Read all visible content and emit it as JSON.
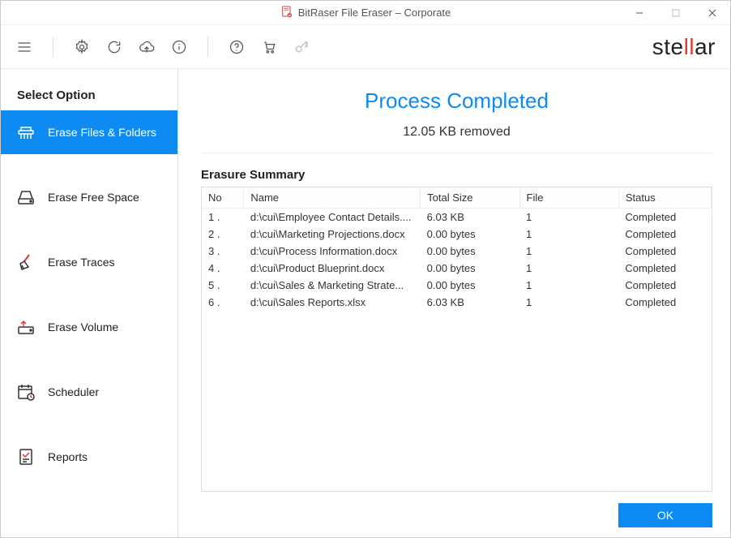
{
  "window": {
    "title": "BitRaser File Eraser – Corporate"
  },
  "brand": {
    "prefix": "ste",
    "ll": "ll",
    "suffix": "ar"
  },
  "sidebar": {
    "title": "Select Option",
    "items": [
      {
        "label": "Erase Files & Folders"
      },
      {
        "label": "Erase Free Space"
      },
      {
        "label": "Erase Traces"
      },
      {
        "label": "Erase Volume"
      },
      {
        "label": "Scheduler"
      },
      {
        "label": "Reports"
      }
    ]
  },
  "result": {
    "headline": "Process Completed",
    "subhead": "12.05 KB removed",
    "section_title": "Erasure Summary",
    "columns": {
      "no": "No",
      "name": "Name",
      "size": "Total Size",
      "file": "File",
      "status": "Status"
    },
    "rows": [
      {
        "no": "1 .",
        "name": "d:\\cui\\Employee Contact Details....",
        "size": "6.03 KB",
        "file": "1",
        "status": "Completed"
      },
      {
        "no": "2 .",
        "name": "d:\\cui\\Marketing Projections.docx",
        "size": "0.00 bytes",
        "file": "1",
        "status": "Completed"
      },
      {
        "no": "3 .",
        "name": "d:\\cui\\Process Information.docx",
        "size": "0.00 bytes",
        "file": "1",
        "status": "Completed"
      },
      {
        "no": "4 .",
        "name": "d:\\cui\\Product Blueprint.docx",
        "size": "0.00 bytes",
        "file": "1",
        "status": "Completed"
      },
      {
        "no": "5 .",
        "name": "d:\\cui\\Sales & Marketing Strate...",
        "size": "0.00 bytes",
        "file": "1",
        "status": "Completed"
      },
      {
        "no": "6 .",
        "name": "d:\\cui\\Sales Reports.xlsx",
        "size": "6.03 KB",
        "file": "1",
        "status": "Completed"
      }
    ]
  },
  "footer": {
    "ok": "OK"
  }
}
